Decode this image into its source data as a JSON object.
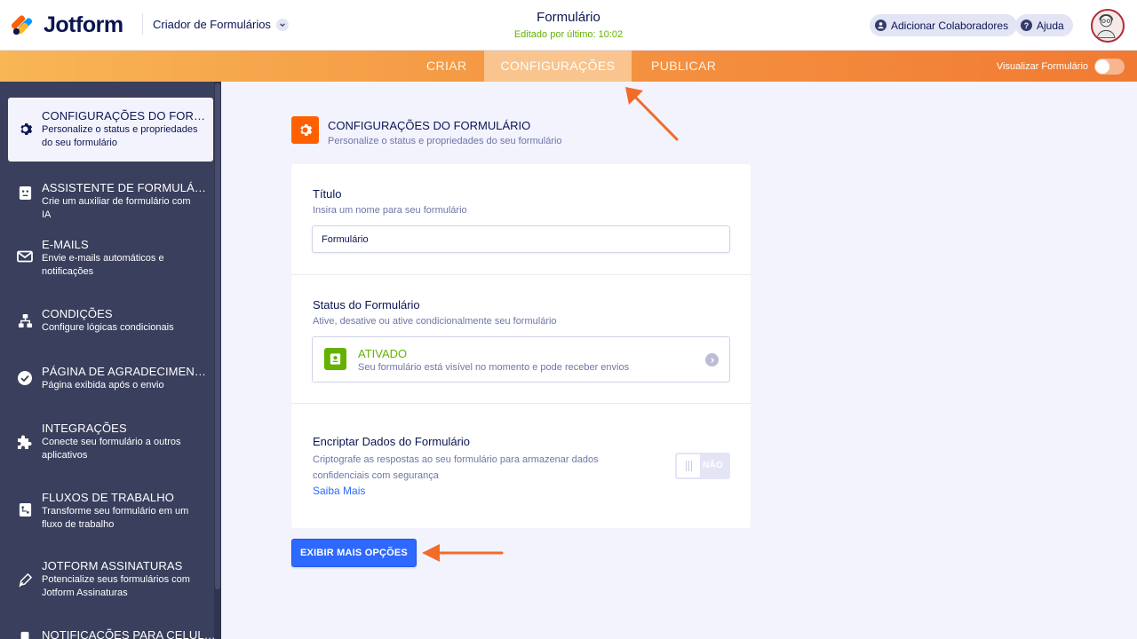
{
  "header": {
    "logo_text": "Jotform",
    "builder_switch": "Criador de Formulários",
    "form_title": "Formulário",
    "edited": "Editado por último: 10:02",
    "add_collaborators": "Adicionar Colaboradores",
    "help": "Ajuda"
  },
  "nav": {
    "tabs": [
      "CRIAR",
      "CONFIGURAÇÕES",
      "PUBLICAR"
    ],
    "active_tab": "CONFIGURAÇÕES",
    "preview_label": "Visualizar Formulário",
    "preview_on": false
  },
  "sidebar": {
    "items": [
      {
        "title": "CONFIGURAÇÕES DO FORM...",
        "desc": "Personalize o status e propriedades do seu formulário",
        "icon": "gear-icon",
        "active": true
      },
      {
        "title": "ASSISTENTE DE FORMULÁRI...",
        "desc": "Crie um auxiliar de formulário com IA",
        "icon": "ai-agent-icon",
        "active": false
      },
      {
        "title": "E-MAILS",
        "desc": "Envie e-mails automáticos e notificações",
        "icon": "envelope-icon",
        "active": false
      },
      {
        "title": "CONDIÇÕES",
        "desc": "Configure lógicas condicionais",
        "icon": "hierarchy-icon",
        "active": false
      },
      {
        "title": "PÁGINA DE AGRADECIMENTO",
        "desc": "Página exibida após o envio",
        "icon": "check-circle-icon",
        "active": false
      },
      {
        "title": "INTEGRAÇÕES",
        "desc": "Conecte seu formulário a outros aplicativos",
        "icon": "puzzle-icon",
        "active": false
      },
      {
        "title": "FLUXOS DE TRABALHO",
        "desc": "Transforme seu formulário em um fluxo de trabalho",
        "icon": "workflow-icon",
        "active": false
      },
      {
        "title": "JOTFORM ASSINATURAS",
        "desc": "Potencialize seus formulários com Jotform Assinaturas",
        "icon": "pen-nib-icon",
        "active": false
      },
      {
        "title": "NOTIFICAÇÕES PARA CELULAR",
        "desc": "",
        "icon": "mobile-icon",
        "active": false
      }
    ]
  },
  "section": {
    "title": "CONFIGURAÇÕES DO FORMULÁRIO",
    "desc": "Personalize o status e propriedades do seu formulário"
  },
  "form_title_field": {
    "label": "Título",
    "desc": "Insira um nome para seu formulário",
    "value": "Formulário"
  },
  "form_status": {
    "label": "Status do Formulário",
    "desc": "Ative, desative ou ative condicionalmente seu formulário",
    "status": "ATIVADO",
    "status_desc": "Seu formulário está visível no momento e pode receber envios"
  },
  "encrypt": {
    "label": "Encriptar Dados do Formulário",
    "desc": "Criptografe as respostas ao seu formulário para armazenar dados confidenciais com segurança",
    "learn_more": "Saiba Mais",
    "toggle_text": "NÃO",
    "enabled": false
  },
  "more_options": "EXIBIR MAIS OPÇÕES",
  "colors": {
    "accent_orange": "#ff6100",
    "primary_blue": "#2e69ff",
    "success_green": "#64b200",
    "navy": "#0a1551",
    "sidebar_bg": "#393f5c"
  }
}
